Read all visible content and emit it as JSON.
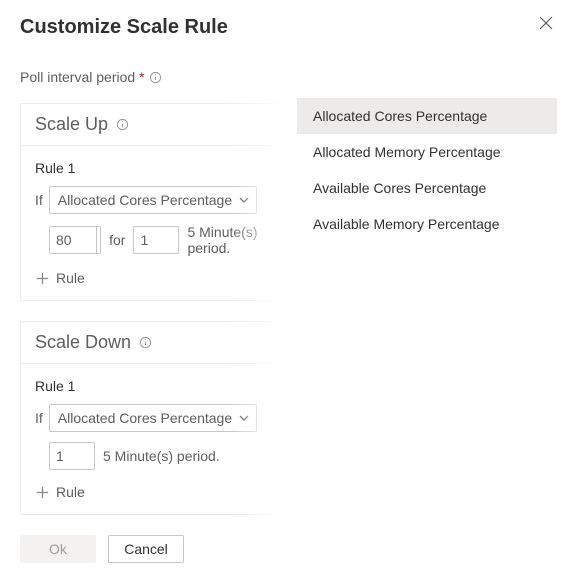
{
  "title": "Customize Scale Rule",
  "poll_label": "Poll interval period",
  "scale_up": {
    "title": "Scale Up",
    "rule_label": "Rule 1",
    "if_text": "If",
    "metric": "Allocated Cores Percentage",
    "threshold": "80",
    "pct_suffix": "%",
    "for_text": "for",
    "duration": "1",
    "period_text": "5 Minute(s) period.",
    "add_rule": "Rule"
  },
  "scale_down": {
    "title": "Scale Down",
    "rule_label": "Rule 1",
    "if_text": "If",
    "metric": "Allocated Cores Percentage",
    "duration": "1",
    "period_text": "5 Minute(s) period.",
    "add_rule": "Rule"
  },
  "buttons": {
    "ok": "Ok",
    "cancel": "Cancel"
  },
  "dropdown_options": [
    "Allocated Cores Percentage",
    "Allocated Memory Percentage",
    "Available Cores Percentage",
    "Available Memory Percentage"
  ]
}
